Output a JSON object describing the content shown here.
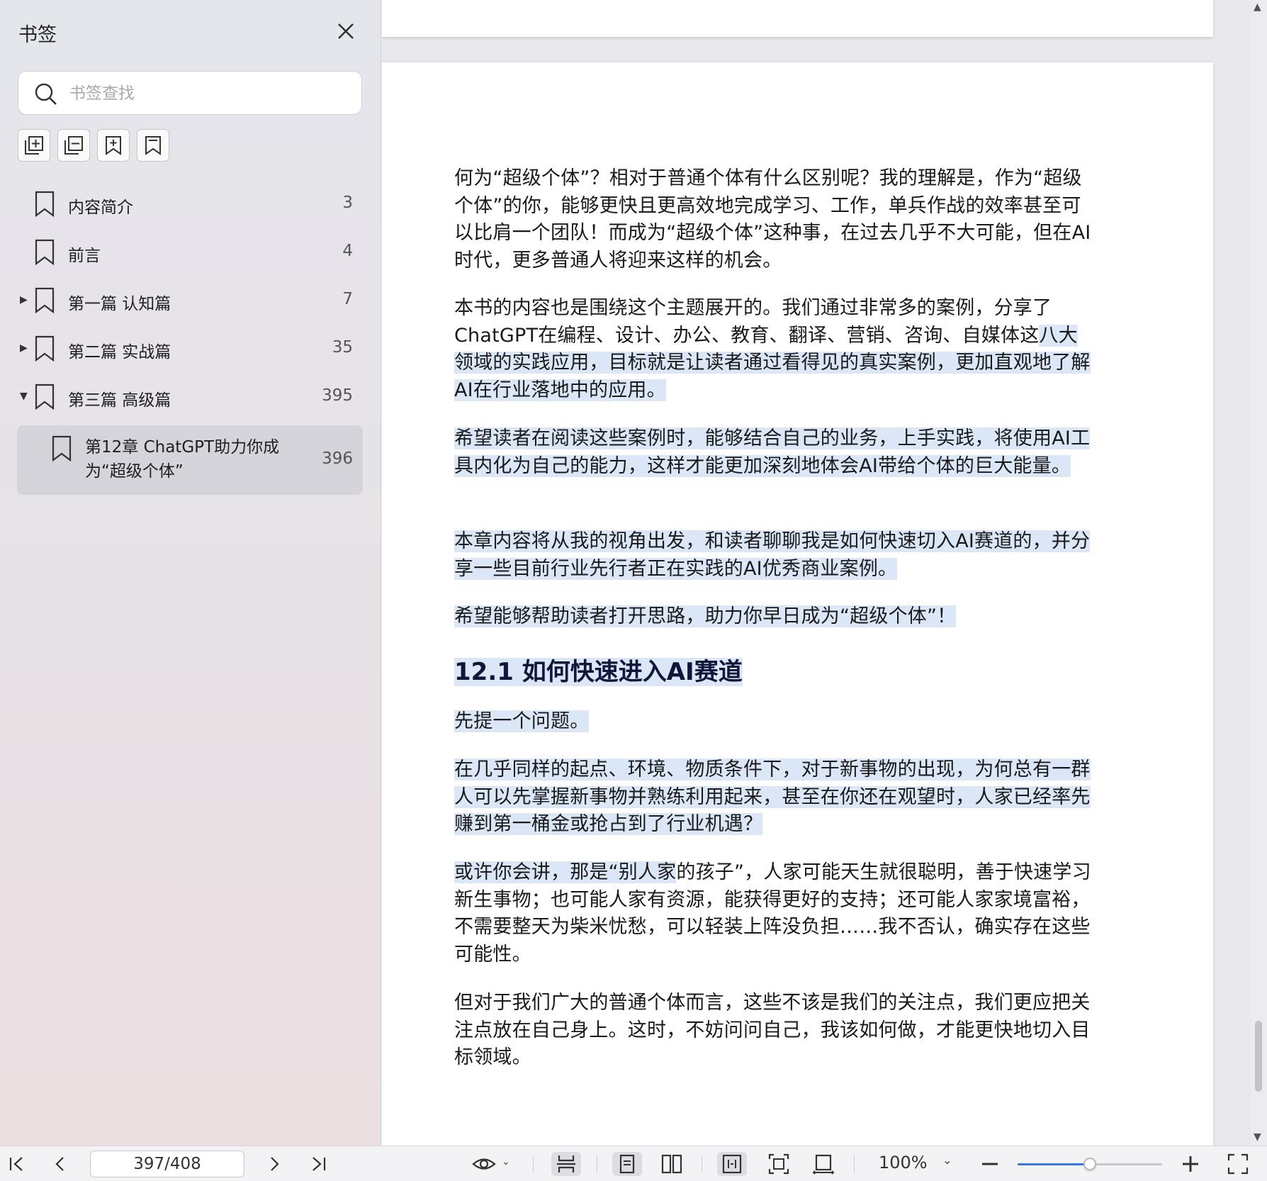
{
  "sidebar": {
    "title": "书签",
    "search_placeholder": "书签查找",
    "bookmarks": [
      {
        "label": "内容简介",
        "page": "3"
      },
      {
        "label": "前言",
        "page": "4"
      },
      {
        "label": "第一篇 认知篇",
        "page": "7"
      },
      {
        "label": "第二篇 实战篇",
        "page": "35"
      },
      {
        "label": "第三篇 高级篇",
        "page": "395"
      }
    ],
    "selected": {
      "label": "第12章 ChatGPT助力你成为“超级个体”",
      "page": "396"
    }
  },
  "document": {
    "p1": "何为“超级个体”？相对于普通个体有什么区别呢？我的理解是，作为“超级个体”的你，能够更快且更高效地完成学习、工作，单兵作战的效率甚至可以比肩一个团队！而成为“超级个体”这种事，在过去几乎不大可能，但在AI时代，更多普通人将迎来这样的机会。",
    "p2a": "本书的内容也是围绕这个主题展开的。我们通过非常多的案例，分享了ChatGPT在编程、设计、办公、教育、翻译、营销、咨询、自媒体这",
    "p2b": "八大领域的实践应用，目标就是让读者通过看得见的真实案例，更加直观地了解AI在行业落地中的应用。",
    "p3": "希望读者在阅读这些案例时，能够结合自己的业务，上手实践，将使用AI工具内化为自己的能力，这样才能更加深刻地体会AI带给个体的巨大能量。",
    "p4": "本章内容将从我的视角出发，和读者聊聊我是如何快速切入AI赛道的，并分享一些目前行业先行者正在实践的AI优秀商业案例。",
    "p5": "希望能够帮助读者打开思路，助力你早日成为“超级个体”！",
    "heading": "12.1 如何快速进入AI赛道",
    "p6": "先提一个问题。",
    "p7": "在几乎同样的起点、环境、物质条件下，对于新事物的出现，为何总有一群人可以先掌握新事物并熟练利用起来，甚至在你还在观望时，人家已经率先赚到第一桶金或抢占到了行业机遇？",
    "p8a": "或许你会讲，那是“别人家",
    "p8b": "的孩子”，人家可能天生就很聪明，善于快速学习新生事物；也可能人家有资源，能获得更好的支持；还可能人家家境富裕，不需要整天为柴米忧愁，可以轻装上阵没负担……我不否认，确实存在这些可能性。",
    "p9": "但对于我们广大的普通个体而言，这些不该是我们的关注点，我们更应把关注点放在自己身上。这时，不妨问问自己，我该如何做，才能更快地切入目标领域。"
  },
  "bottombar": {
    "page_value": "397/408",
    "zoom": "100%",
    "zoom_level_percent": 50
  },
  "colors": {
    "highlight": "#dbe6f6",
    "accent": "#3a78e0"
  }
}
